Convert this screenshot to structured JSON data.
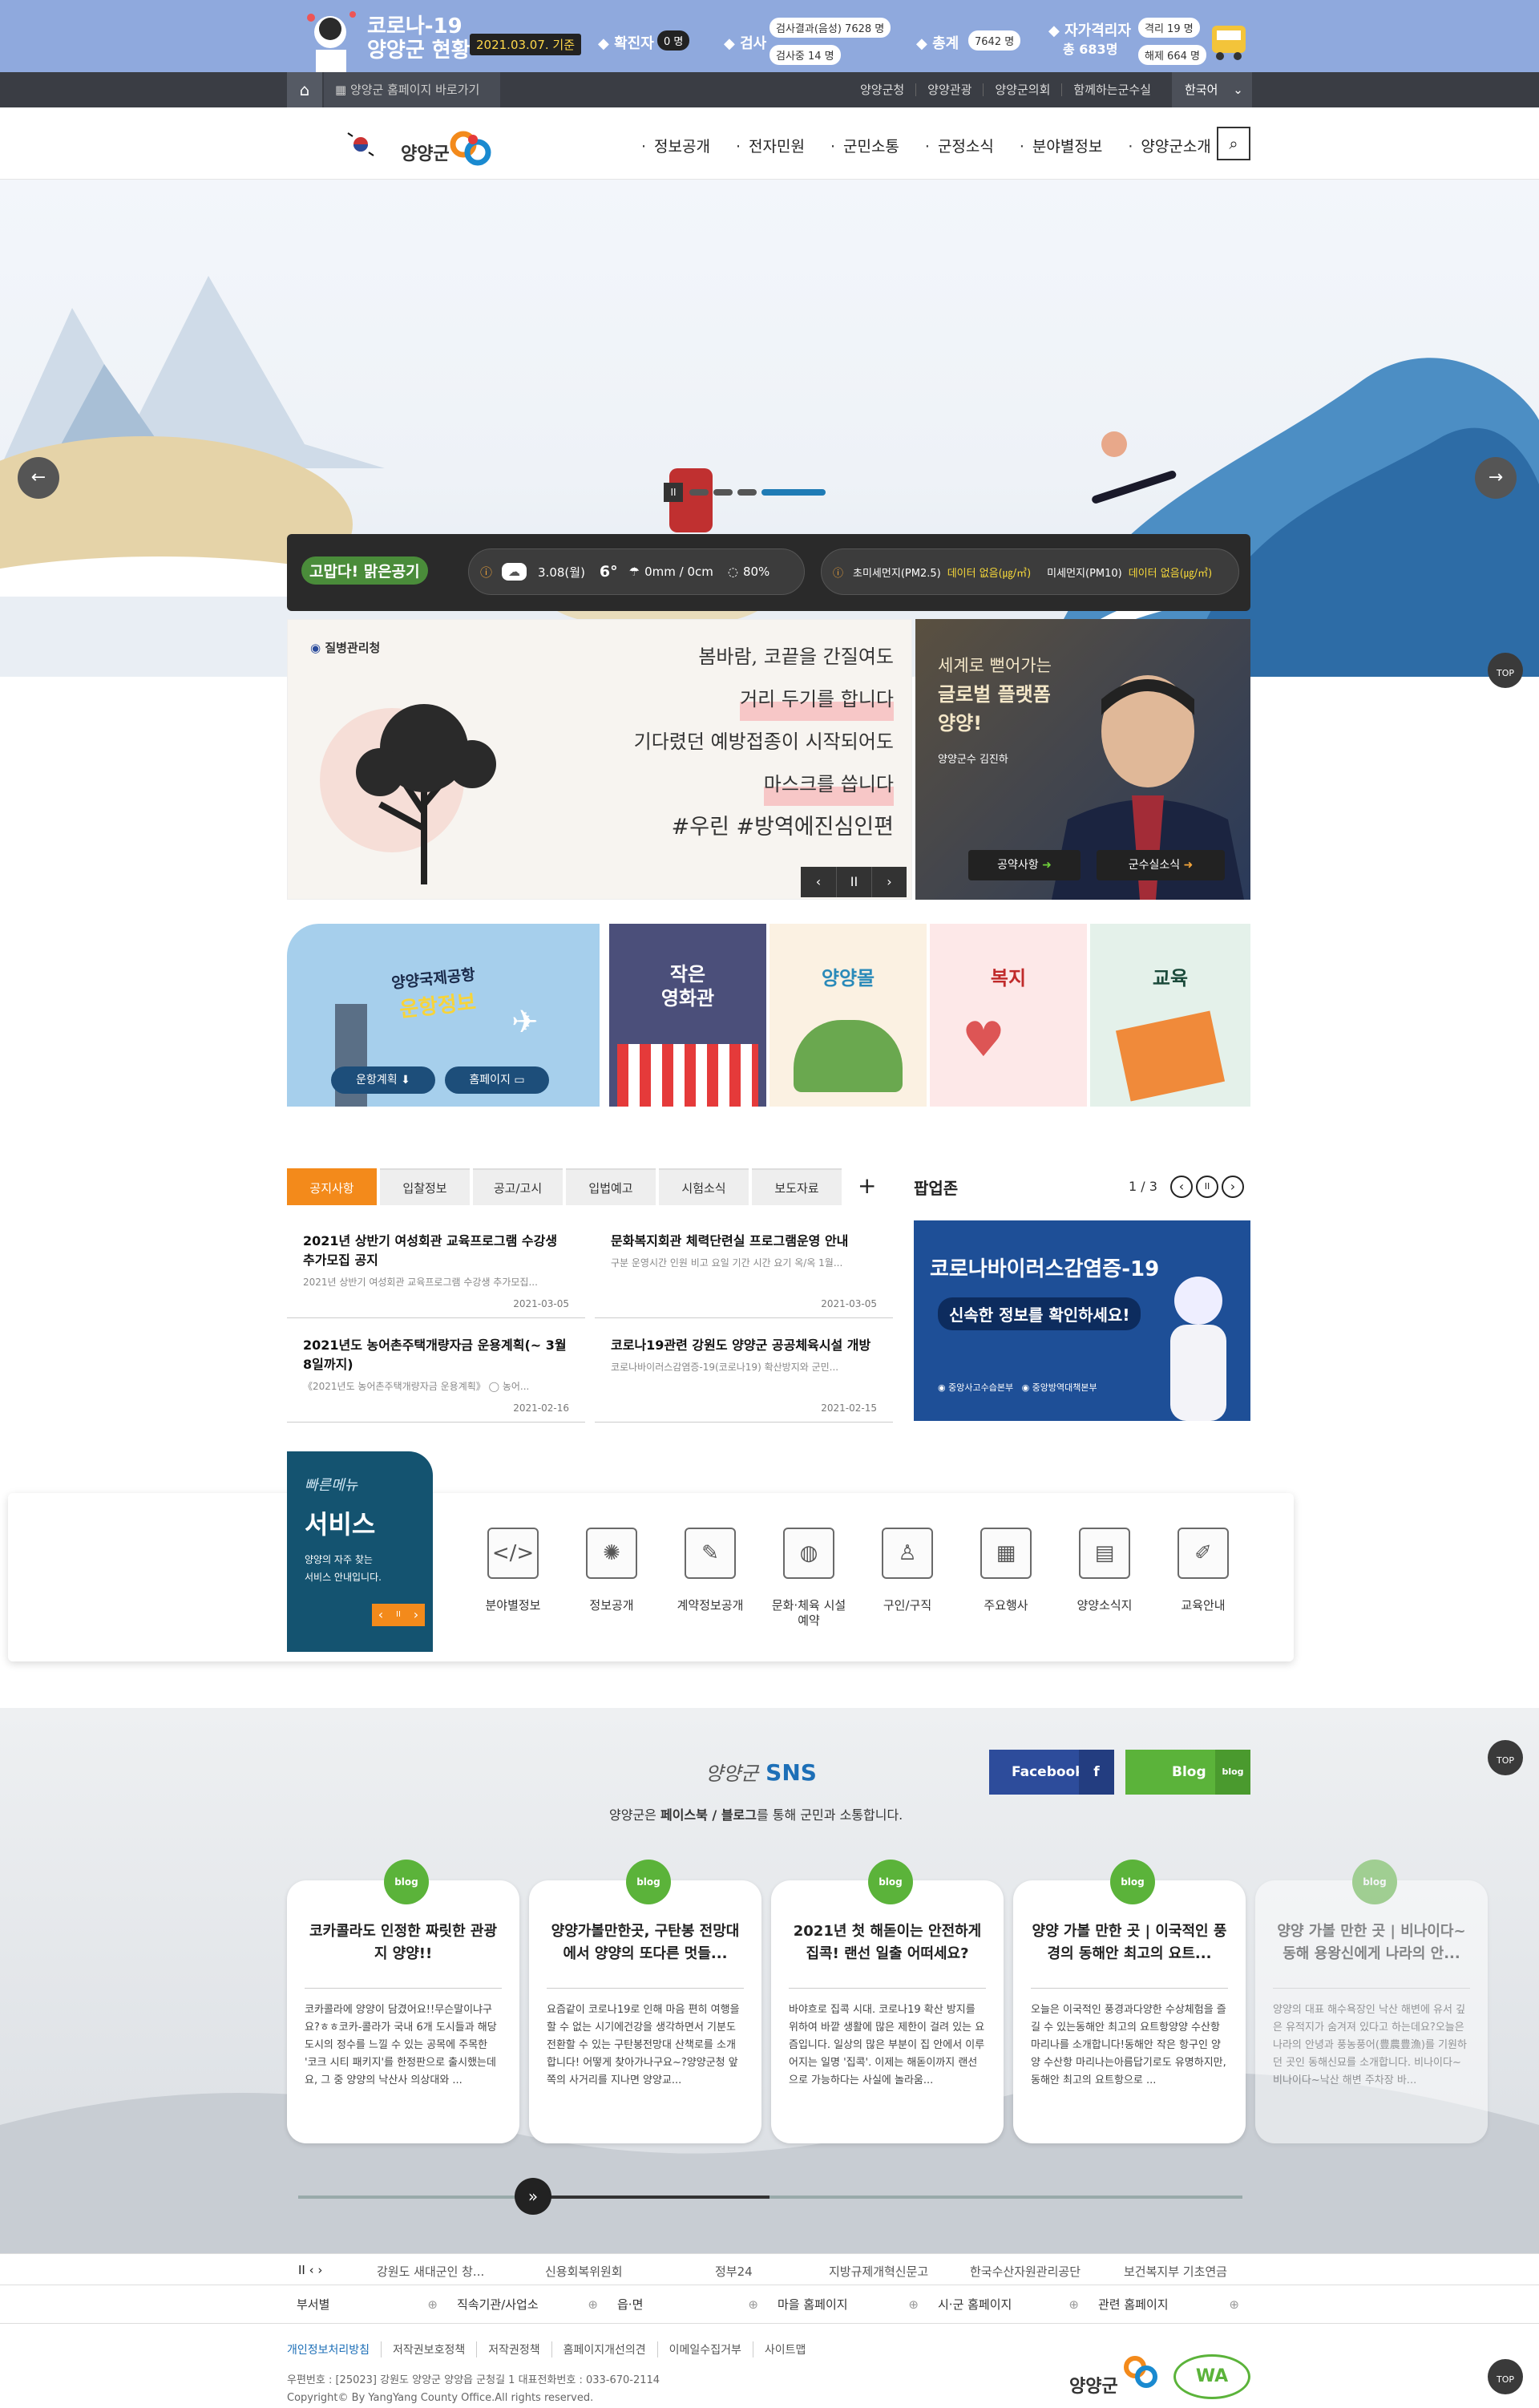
{
  "covid": {
    "title1": "코로나-19",
    "title2": "양양군 현황",
    "date": "2021.03.07. 기준",
    "confirmed_label": "확진자",
    "confirmed_value": "0 명",
    "test_label": "검사",
    "test_result_label": "검사결과(음성)",
    "test_result_value": "7628 명",
    "testing": "검사중 14 명",
    "total_label": "총계",
    "total_value": "7642 명",
    "quarantine_label": "자가격리자",
    "quarantine_total": "총 683명",
    "quarantine_sub1": "격리 19 명",
    "quarantine_sub2": "해제 664 명"
  },
  "util": {
    "shortcut": "양양군 홈페이지 바로가기",
    "links": [
      "양양군청",
      "양양관광",
      "양양군의회",
      "함께하는군수실"
    ],
    "lang": "한국어"
  },
  "header": {
    "logo": "양양군",
    "nav": [
      "정보공개",
      "전자민원",
      "군민소통",
      "군정소식",
      "분야별정보",
      "양양군소개"
    ]
  },
  "weather": {
    "brand": "고맙다! 맑은공기",
    "date": "3.08(월)",
    "temp": "6°",
    "rain": "0mm / 0cm",
    "humidity": "80%",
    "pm25_label": "초미세먼지(PM2.5)",
    "pm25_value": "데이터 없음(㎍/㎥)",
    "pm10_label": "미세먼지(PM10)",
    "pm10_value": "데이터 없음(㎍/㎥)"
  },
  "campaign": {
    "agency": "질병관리청",
    "lines": [
      "봄바람, 코끝을 간질여도",
      "거리 두기를 합니다",
      "기다렸던 예방접종이 시작되어도",
      "마스크를 씁니다"
    ],
    "hashtag": "#우린 #방역에진심인편"
  },
  "mayor": {
    "line1": "세계로 뻗어가는",
    "line2": "글로벌 플랫폼",
    "line3": "양양!",
    "name": "양양군수 김진하",
    "btn1": "공약사항",
    "btn2": "군수실소식"
  },
  "tiles": {
    "airport_title": "양양국제공항",
    "airport_sub": "운항정보",
    "airport_btn1": "운항계획",
    "airport_btn2": "홈페이지",
    "cinema_top": "작은",
    "cinema": "영화관",
    "mall": "양양몰",
    "welfare": "복지",
    "education": "교육"
  },
  "notice": {
    "tabs": [
      "공지사항",
      "입찰정보",
      "공고/고시",
      "입법예고",
      "시험소식",
      "보도자료"
    ],
    "more": "+",
    "items": [
      {
        "title": "2021년 상반기 여성회관 교육프로그램 수강생 추가모집 공지",
        "desc": "2021년 상반기 여성회관 교육프로그램 수강생 추가모집...",
        "date": "2021-03-05"
      },
      {
        "title": "문화복지회관 체력단련실 프로그램운영 안내",
        "desc": "구분 운영시간 인원 비고 요일 기간 시간 요기 옥/옥 1월...",
        "date": "2021-03-05"
      },
      {
        "title": "2021년도 농어촌주택개량자금 운용계획(~ 3월8일까지)",
        "desc": "《2021년도 농어촌주택개량자금 운용계획》 ◯ 농어...",
        "date": "2021-02-16"
      },
      {
        "title": "코로나19관련 강원도 양양군 공공체육시설 개방",
        "desc": "코로나바이러스감염증-19(코로나19) 확산방지와 군민...",
        "date": "2021-02-15"
      }
    ]
  },
  "popup": {
    "title": "팝업존",
    "page": "1 / 3",
    "banner1": "코로나바이러스감염증-19",
    "banner2": "신속한 정보를 확인하세요!",
    "org1": "중앙사고수습본부",
    "org2": "중앙방역대책본부"
  },
  "quick": {
    "script": "빠른메뉴",
    "title": "서비스",
    "desc1": "양양의 자주 찾는",
    "desc2": "서비스 안내입니다.",
    "items": [
      "분야별정보",
      "정보공개",
      "계약정보공개",
      "문화·체육 시설 예약",
      "구인/구직",
      "주요행사",
      "양양소식지",
      "교육안내"
    ]
  },
  "sns": {
    "script": "양양군",
    "title": "SNS",
    "desc_pre": "양양군은 ",
    "desc_bold": "페이스북 / 블로그",
    "desc_post": "를 통해 군민과 소통합니다.",
    "facebook": "Facebook",
    "blog": "Blog",
    "badge": "blog",
    "cards": [
      {
        "title": "코카콜라도 인정한 짜릿한 관광지 양양!!",
        "body": "코카콜라에 양양이 담겼어요!!무슨말이냐구요?ㅎㅎ코카-콜라가 국내 6개 도시들과 해당 도시의 정수를 느낄 수 있는 공목에 주목한 '코크 시티 패키지'를 한정판으로 출시했는데요, 그 중 양양의 낙산사 의상대와 ..."
      },
      {
        "title": "양양가볼만한곳, 구탄봉 전망대에서 양양의 또다른 멋들...",
        "body": "요즘같이 코로나19로 인해 마음 편히 여행을 할 수 없는 시기에건강을 생각하면서 기분도 전환할 수 있는 구탄봉전망대 산책로를 소개합니다! 어떻게 찾아가나구요~?양양군청 앞쪽의 사거리를 지나면 양양교..."
      },
      {
        "title": "2021년 첫 해돋이는 안전하게 집콕! 랜선 일출 어떠세요?",
        "body": "바야흐로 집콕 시대. 코로나19 확산 방지를 위하여 바깥 생활에 많은 제한이 걸려 있는 요즘입니다. 일상의 많은 부분이 집 안에서 이루어지는 일명 '집콕'. 이제는 해돋이까지 랜선으로 가능하다는 사실에 놀라움..."
      },
      {
        "title": "양양 가볼 만한 곳 | 이국적인 풍경의 동해안 최고의 요트...",
        "body": "오늘은 이국적인 풍경과다양한 수상체험을 즐길 수 있는동해안 최고의 요트항양양 수산항 마리나를 소개합니다!동해안 작은 항구인 양양 수산항 마리나는아름답기로도 유명하지만,동해안 최고의 요트항으로 ..."
      },
      {
        "title": "양양 가볼 만한 곳 | 비나이다~ 동해 용왕신에게 나라의 안...",
        "body": "양양의 대표 해수욕장인 낙산 해변에 유서 깊은 유적지가 숨겨져 있다고 하는데요?오늘은 나라의 안녕과 풍농풍어(豊農豊漁)를 기원하던 곳인 동해신묘를 소개합니다. 비나이다~비나이다~낙산 해변 주차장 바..."
      }
    ]
  },
  "footer": {
    "links": [
      "강원도 새대군인 창...",
      "신용회복위원회",
      "정부24",
      "지방규제개혁신문고",
      "한국수산자원관리공단",
      "보건복지부 기초연금"
    ],
    "selects": [
      "부서별",
      "직속기관/사업소",
      "읍·면",
      "마을 홈페이지",
      "시·군 홈페이지",
      "관련 홈페이지"
    ],
    "policy": [
      "개인정보처리방침",
      "저작권보호정책",
      "저작권정책",
      "홈페이지개선의견",
      "이메일수집거부",
      "사이트맵"
    ],
    "address": "우편번호 : [25023] 강원도 양양군 양양읍 군청길 1 대표전화번호 : 033-670-2114",
    "copyright": "Copyright© By YangYang County Office.All rights reserved.",
    "logo": "양양군",
    "wa": "WA",
    "top": "TOP"
  }
}
